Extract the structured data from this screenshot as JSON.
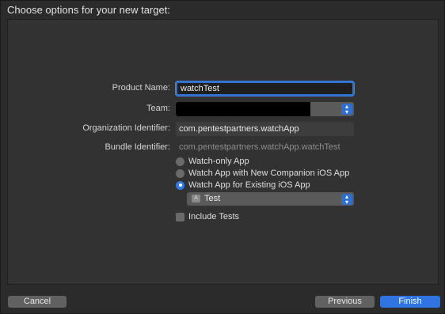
{
  "dialog": {
    "title": "Choose options for your new target:"
  },
  "form": {
    "product_name_label": "Product Name:",
    "product_name_value": "watchTest",
    "team_label": "Team:",
    "org_id_label": "Organization Identifier:",
    "org_id_value": "com.pentestpartners.watchApp",
    "bundle_id_label": "Bundle Identifier:",
    "bundle_id_value": "com.pentestpartners.watchApp.watchTest",
    "app_type_options": [
      {
        "label": "Watch-only App",
        "selected": false
      },
      {
        "label": "Watch App with New Companion iOS App",
        "selected": false
      },
      {
        "label": "Watch App for Existing iOS App",
        "selected": true
      }
    ],
    "existing_app_value": "Test",
    "include_tests_label": "Include Tests",
    "include_tests_checked": false
  },
  "buttons": {
    "cancel": "Cancel",
    "previous": "Previous",
    "finish": "Finish"
  },
  "colors": {
    "accent": "#2f74e0",
    "background": "#2b2b2b"
  }
}
